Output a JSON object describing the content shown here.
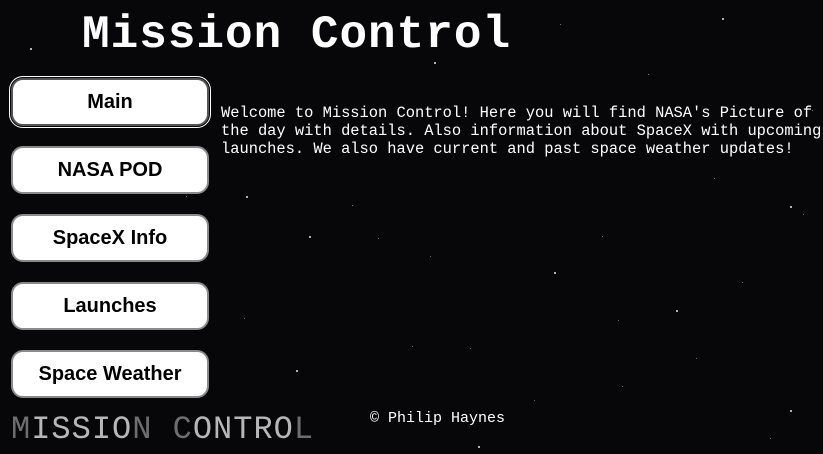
{
  "header": {
    "title": "Mission Control"
  },
  "nav": {
    "items": [
      {
        "label": "Main",
        "active": true
      },
      {
        "label": "NASA POD",
        "active": false
      },
      {
        "label": "SpaceX Info",
        "active": false
      },
      {
        "label": "Launches",
        "active": false
      },
      {
        "label": "Space Weather",
        "active": false
      }
    ]
  },
  "main": {
    "welcome_text": "Welcome to Mission Control! Here you will find NASA's Picture of the day with details. Also information about SpaceX with upcoming launches. We also have current and past space weather updates!"
  },
  "footer": {
    "logo_parts": [
      "M",
      "ISSIO",
      "N ",
      "C",
      "ONTRO",
      "L"
    ],
    "copyright": "© Philip Haynes"
  },
  "theme": {
    "background": "#07070a",
    "button_bg": "#ffffff",
    "text": "#ffffff"
  }
}
